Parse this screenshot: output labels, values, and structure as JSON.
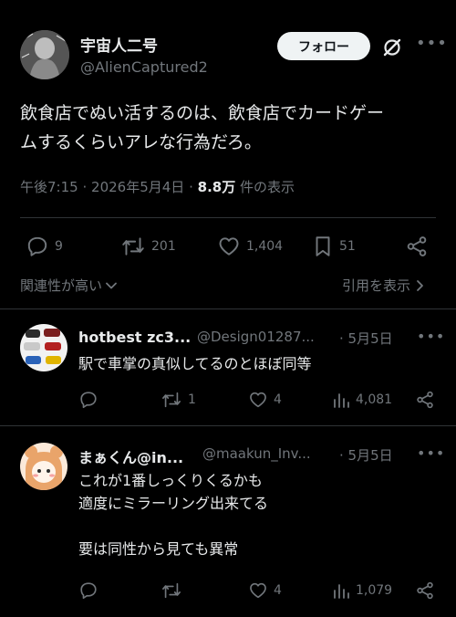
{
  "main_tweet": {
    "display_name": "宇宙人二号",
    "handle": "@AlienCaptured2",
    "follow_label": "フォロー",
    "more_label": "•••",
    "text_line1": "飲食店でぬい活するのは、飲食店でカードゲー",
    "text_line2": "ムするくらいアレな行為だろ。",
    "time": "午後7:15",
    "dot": "·",
    "date": "2026年5月4日",
    "views_count": "8.8万",
    "views_label": "件の表示",
    "actions": {
      "replies": "9",
      "reposts": "201",
      "likes": "1,404",
      "bookmarks": "51"
    },
    "relevance_label": "関連性が高い",
    "quotes_label": "引用を表示"
  },
  "replies": [
    {
      "display_name": "hotbest zc3...",
      "handle": "@Design01287...",
      "date": "· 5月5日",
      "lines": [
        "駅で車掌の真似してるのとほぼ同等"
      ],
      "replies": "",
      "reposts": "1",
      "likes": "4",
      "views": "4,081"
    },
    {
      "display_name": "まぁくん@in...",
      "handle": "@maakun_Inv...",
      "date": "· 5月5日",
      "lines": [
        "これが1番しっくりくるかも",
        "適度にミラーリング出来てる",
        "",
        "要は同性から見ても異常"
      ],
      "replies": "",
      "reposts": "",
      "likes": "4",
      "views": "1,079"
    }
  ],
  "colors": {
    "background": "#000000",
    "text": "#e7e9ea",
    "muted": "#71767b",
    "divider": "#2f3336",
    "follow_bg": "#eff3f4"
  }
}
